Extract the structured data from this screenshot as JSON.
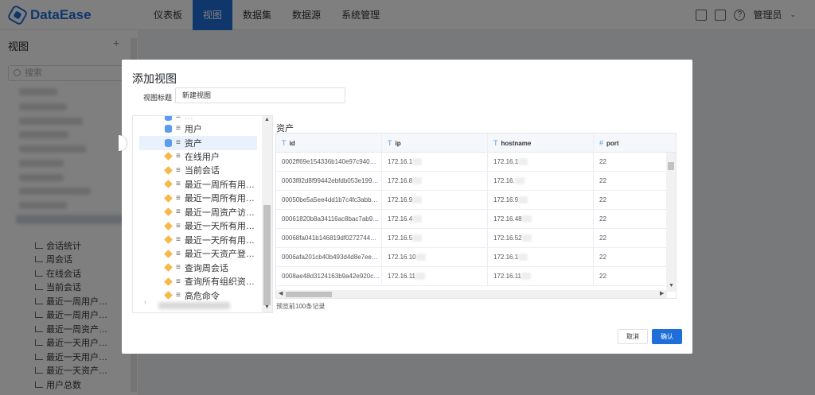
{
  "app": {
    "name": "DataEase"
  },
  "nav": {
    "items": [
      {
        "label": "仪表板",
        "active": false
      },
      {
        "label": "视图",
        "active": true
      },
      {
        "label": "数据集",
        "active": false
      },
      {
        "label": "数据源",
        "active": false
      },
      {
        "label": "系统管理",
        "active": false
      }
    ]
  },
  "header": {
    "user": "管理员",
    "icons": [
      "notification-icon",
      "dataset-icon",
      "help-icon",
      "chevron-down-icon"
    ]
  },
  "sidebar": {
    "title": "视图",
    "add": "+",
    "search_placeholder": "搜索",
    "items": [
      "会话统计",
      "周会话",
      "在线会话",
      "当前会话",
      "最近一周用户…",
      "最近一周用户…",
      "最近一周资产…",
      "最近一天用户…",
      "最近一天用户…",
      "最近一天资产…",
      "用户总数"
    ]
  },
  "dialog": {
    "title": "添加视图",
    "name_label": "视图标题",
    "name_value": "新建视图",
    "tree": {
      "items": [
        {
          "label": "用户",
          "icon": "database-icon",
          "selected": false
        },
        {
          "label": "资产",
          "icon": "database-icon",
          "selected": true
        },
        {
          "label": "在线用户",
          "icon": "cube-icon",
          "selected": false
        },
        {
          "label": "当前会话",
          "icon": "cube-icon",
          "selected": false
        },
        {
          "label": "最近一周所有用…",
          "icon": "cube-icon",
          "selected": false
        },
        {
          "label": "最近一周所有用…",
          "icon": "cube-icon",
          "selected": false
        },
        {
          "label": "最近一周资产访…",
          "icon": "cube-icon",
          "selected": false
        },
        {
          "label": "最近一天所有用…",
          "icon": "cube-icon",
          "selected": false
        },
        {
          "label": "最近一天所有用…",
          "icon": "cube-icon",
          "selected": false
        },
        {
          "label": "最近一天资产登…",
          "icon": "cube-icon",
          "selected": false
        },
        {
          "label": "查询周会话",
          "icon": "cube-icon",
          "selected": false
        },
        {
          "label": "查询所有组织资…",
          "icon": "cube-icon",
          "selected": false
        },
        {
          "label": "高危命令",
          "icon": "cube-icon",
          "selected": false
        }
      ]
    },
    "preview": {
      "title": "资产",
      "columns": [
        {
          "name": "id",
          "type_glyph": "T"
        },
        {
          "name": "ip",
          "type_glyph": "T"
        },
        {
          "name": "hostname",
          "type_glyph": "T"
        },
        {
          "name": "port",
          "type_glyph": "#"
        }
      ],
      "rows": [
        [
          "0002ff69e154336b140e97c940…",
          "172.16.1",
          "172.16.1",
          "22"
        ],
        [
          "0003f82d8f99442ebfdb053e199…",
          "172.16.8",
          "172.16.",
          "22"
        ],
        [
          "00050be5a5ee4dd1b7c4fc3abb…",
          "172.16.9",
          "172.16.9",
          "22"
        ],
        [
          "00061820b8a34116ac8bac7ab9…",
          "172.16.4",
          "172.16.48",
          "22"
        ],
        [
          "00068fa041b146819df0272744…",
          "172.16.5",
          "172.16.52",
          "22"
        ],
        [
          "0006afa201cb40b493d4d8e7ee…",
          "172.16.10",
          "172.16.1",
          "22"
        ],
        [
          "0008ae48d3124163b9a42e920c…",
          "172.16.11",
          "172.16.11",
          "22"
        ]
      ],
      "note": "预览前100条记录"
    },
    "cancel": "取消",
    "confirm": "确认"
  }
}
